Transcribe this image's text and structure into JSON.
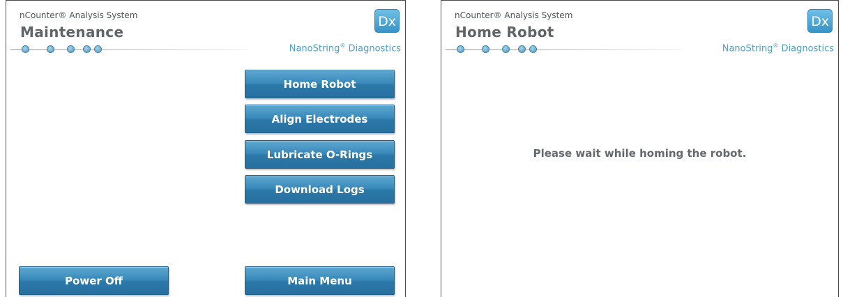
{
  "colors": {
    "button_top": "#5ea8d0",
    "button_bottom": "#27709f",
    "brand_blue": "#4fa0c8",
    "title_gray": "#5f6468"
  },
  "left_screen": {
    "system_name": "nCounter® Analysis System",
    "page_title": "Maintenance",
    "badge": "Dx",
    "brand": "NanoString",
    "brand_reg": "®",
    "brand_suffix": " Diagnostics",
    "progress_steps": 5,
    "buttons": {
      "home_robot": "Home Robot",
      "align_electrodes": "Align Electrodes",
      "lubricate_orings": "Lubricate O-Rings",
      "download_logs": "Download Logs",
      "power_off": "Power Off",
      "main_menu": "Main Menu"
    }
  },
  "right_screen": {
    "system_name": "nCounter® Analysis System",
    "page_title": "Home Robot",
    "badge": "Dx",
    "brand": "NanoString",
    "brand_reg": "®",
    "brand_suffix": " Diagnostics",
    "progress_steps": 5,
    "message": "Please wait while homing the robot."
  }
}
